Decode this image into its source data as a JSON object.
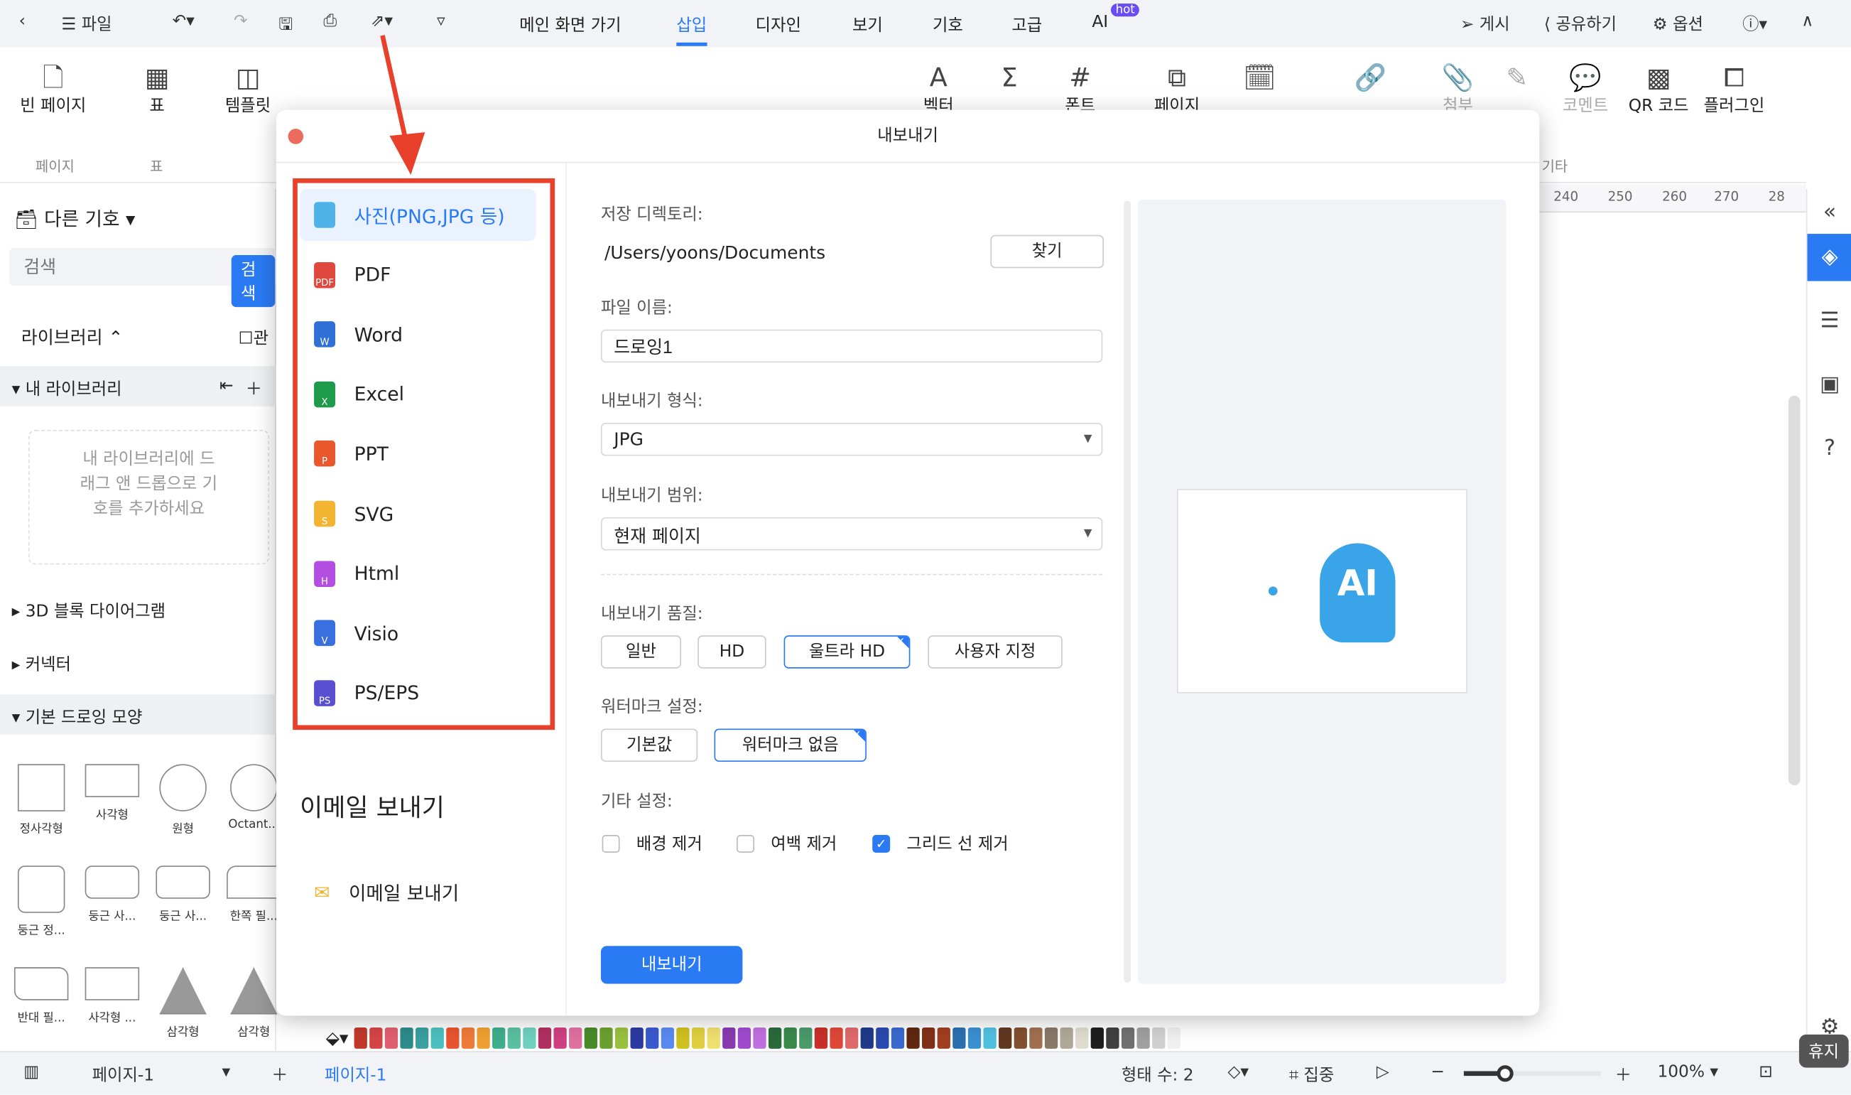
{
  "topbar": {
    "file": "파일",
    "tabs": [
      "메인 화면 가기",
      "삽입",
      "디자인",
      "보기",
      "기호",
      "고급",
      "AI"
    ],
    "active_tab": "삽입",
    "hot_badge": "hot",
    "publish": "게시",
    "share": "공유하기",
    "options": "옵션"
  },
  "ribbon": {
    "buttons": [
      {
        "label": "빈 페이지",
        "icon": "blank-page-icon",
        "glyph": "🗋"
      },
      {
        "label": "표",
        "icon": "table-icon",
        "glyph": "▦"
      },
      {
        "label": "템플릿",
        "icon": "template-icon",
        "glyph": "◫"
      },
      {
        "label": "벡터",
        "icon": "vector-text-icon",
        "glyph": "A"
      },
      {
        "label": "",
        "icon": "formula-icon",
        "glyph": "Σ"
      },
      {
        "label": "폰트",
        "icon": "hash-icon",
        "glyph": "#"
      },
      {
        "label": "페이지",
        "icon": "page-number-icon",
        "glyph": "⧉"
      },
      {
        "label": "",
        "icon": "date-icon",
        "glyph": "🗓"
      },
      {
        "label": "",
        "icon": "hyperlink-icon",
        "glyph": "🔗"
      },
      {
        "label": "첨부",
        "icon": "attachment-icon",
        "glyph": "📎"
      },
      {
        "label": "",
        "icon": "pen-icon",
        "glyph": "✎"
      },
      {
        "label": "코멘트",
        "icon": "comment-icon",
        "glyph": "💬"
      },
      {
        "label": "QR 코드",
        "icon": "qr-code-icon",
        "glyph": "▩"
      },
      {
        "label": "플러그인",
        "icon": "plugin-icon",
        "glyph": "⧠"
      }
    ],
    "groups": [
      "페이지",
      "표",
      "기타"
    ]
  },
  "left": {
    "title": "다른 기호",
    "search_placeholder": "검색",
    "search_button": "검색",
    "library": "라이브러리",
    "manage": "관",
    "my_library": "내 라이브러리",
    "empty_hint": "내 라이브러리에 드래그 앤 드롭으로 기호를 추가하세요",
    "sections": [
      "3D 블록 다이어그램",
      "커넥터",
      "기본 드로잉 모양"
    ],
    "shapes": [
      "정사각형",
      "사각형",
      "원형",
      "Octant...",
      "둥근 정...",
      "둥근 사...",
      "둥근 사...",
      "한쪽 필...",
      "반대 필...",
      "사각형 ...",
      "삼각형",
      "삼각형"
    ]
  },
  "ruler": [
    "240",
    "250",
    "260",
    "270",
    "28"
  ],
  "dialog": {
    "title": "내보내기",
    "formats": [
      {
        "label": "사진(PNG,JPG 등)",
        "color": "#4fb3e8",
        "letter": ""
      },
      {
        "label": "PDF",
        "color": "#e0483e",
        "letter": "PDF"
      },
      {
        "label": "Word",
        "color": "#2f6fd6",
        "letter": "W"
      },
      {
        "label": "Excel",
        "color": "#1e9a4b",
        "letter": "X"
      },
      {
        "label": "PPT",
        "color": "#e8582c",
        "letter": "P"
      },
      {
        "label": "SVG",
        "color": "#f2b431",
        "letter": "S"
      },
      {
        "label": "Html",
        "color": "#b24ee0",
        "letter": "H"
      },
      {
        "label": "Visio",
        "color": "#3a6fe0",
        "letter": "V"
      },
      {
        "label": "PS/EPS",
        "color": "#5a4fd0",
        "letter": "PS"
      }
    ],
    "selected_format": "사진(PNG,JPG 등)",
    "email_heading": "이메일 보내기",
    "email_item": "이메일 보내기",
    "dir_label": "저장 디렉토리:",
    "dir_value": "/Users/yoons/Documents",
    "browse": "찾기",
    "name_label": "파일 이름:",
    "name_value": "드로잉1",
    "format_label": "내보내기 형식:",
    "format_value": "JPG",
    "range_label": "내보내기 범위:",
    "range_value": "현재 페이지",
    "quality_label": "내보내기 품질:",
    "quality_options": [
      "일반",
      "HD",
      "울트라 HD",
      "사용자 지정"
    ],
    "quality_selected": "울트라 HD",
    "watermark_label": "워터마크 설정:",
    "watermark_options": [
      "기본값",
      "워터마크 없음"
    ],
    "watermark_selected": "워터마크 없음",
    "other_label": "기타 설정:",
    "other_options": [
      {
        "label": "배경 제거",
        "checked": false
      },
      {
        "label": "여백 제거",
        "checked": false
      },
      {
        "label": "그리드 선 제거",
        "checked": true
      }
    ],
    "export_button": "내보내기",
    "preview_text": "AI"
  },
  "bottom": {
    "page_select": "페이지-1",
    "page_tab": "페이지-1",
    "shape_count": "형태 수: 2",
    "focus": "집중",
    "zoom": "100%",
    "zoom_level": 0.3,
    "tooltip": "휴지"
  },
  "palette": [
    "#c0392b",
    "#d64545",
    "#e06070",
    "#2e8b8b",
    "#3aa0a0",
    "#4cc0c0",
    "#e8552e",
    "#f07a3a",
    "#f0a030",
    "#3fae8a",
    "#5ac0a0",
    "#70d0c0",
    "#b03060",
    "#d04080",
    "#e070a0",
    "#4a8a2a",
    "#6aa030",
    "#9ac040",
    "#2a3aa0",
    "#3a5ad0",
    "#5a8af0",
    "#d0c020",
    "#e0d040",
    "#f0e070",
    "#8a3ab0",
    "#a04ad0",
    "#c070e0",
    "#2a6a3a",
    "#3a8a4a",
    "#4a9a6a",
    "#c83028",
    "#e04838",
    "#e06a6a",
    "#203a8a",
    "#2a4ab0",
    "#3a6ad0",
    "#602810",
    "#803018",
    "#a04020",
    "#2a70b0",
    "#3a90d0",
    "#50c0e0",
    "#603820",
    "#805030",
    "#a07050",
    "#887868",
    "#b0a898",
    "#e0dcd0",
    "#1e1e1e",
    "#404040",
    "#707070",
    "#a0a0a0",
    "#d0d0d0",
    "#f0f0f0"
  ]
}
